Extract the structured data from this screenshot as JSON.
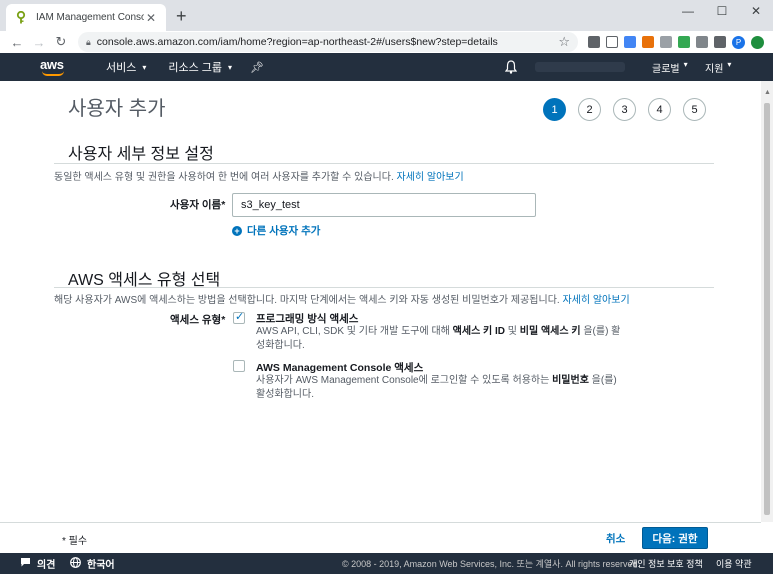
{
  "browser": {
    "tab_title": "IAM Management Console",
    "tab_close": "✕",
    "new_tab": "+",
    "url": "console.aws.amazon.com/iam/home?region=ap-northeast-2#/users$new?step=details",
    "profile_letter": "P"
  },
  "aws_nav": {
    "logo": "aws",
    "services": "서비스",
    "resource_groups": "리소스 그룹",
    "region": "글로벌",
    "support": "지원"
  },
  "page": {
    "title": "사용자 추가",
    "steps": [
      "1",
      "2",
      "3",
      "4",
      "5"
    ],
    "active_step": 1
  },
  "details": {
    "title": "사용자 세부 정보 설정",
    "desc": "동일한 액세스 유형 및 권한을 사용하여 한 번에 여러 사용자를 추가할 수 있습니다.",
    "learn_more": "자세히 알아보기",
    "username_label": "사용자 이름*",
    "username_value": "s3_key_test",
    "add_user": "다른 사용자 추가"
  },
  "access": {
    "title": "AWS 액세스 유형 선택",
    "desc": "해당 사용자가 AWS에 액세스하는 방법을 선택합니다. 마지막 단계에서는 액세스 키와 자동 생성된 비밀번호가 제공됩니다.",
    "learn_more": "자세히 알아보기",
    "type_label": "액세스 유형*",
    "programmatic": {
      "checked": true,
      "title": "프로그래밍 방식 액세스",
      "desc_pre": "AWS API, CLI, SDK 및 기타 개발 도구에 대해 ",
      "desc_bold1": "액세스 키 ID",
      "desc_mid": " 및 ",
      "desc_bold2": "비밀 액세스 키",
      "desc_post": " 을(를) 활성화합니다."
    },
    "console": {
      "checked": false,
      "title": "AWS Management Console 액세스",
      "desc_pre": "사용자가 AWS Management Console에 로그인할 수 있도록 허용하는 ",
      "desc_bold": "비밀번호",
      "desc_post": " 을(를) 활성화합니다."
    }
  },
  "actions": {
    "required": "* 필수",
    "cancel": "취소",
    "next": "다음: 권한"
  },
  "footer": {
    "feedback": "의견",
    "language": "한국어",
    "copyright": "© 2008 - 2019, Amazon Web Services, Inc. 또는 계열사. All rights reserved.",
    "privacy": "개인 정보 보호 정책",
    "terms": "이용 약관"
  },
  "colors": {
    "aws_dark": "#232f3e",
    "primary": "#0073bb",
    "aws_orange": "#ff9900"
  }
}
